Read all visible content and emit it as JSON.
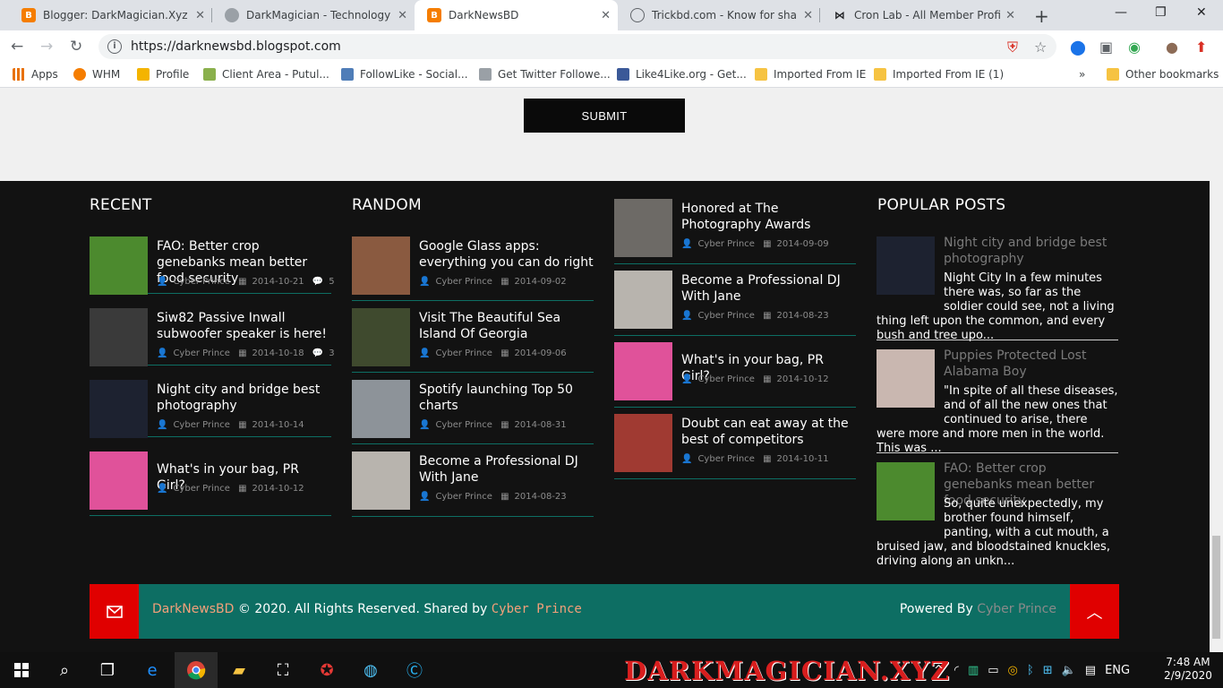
{
  "browser": {
    "tabs": [
      {
        "title": "Blogger: DarkMagician.Xyz - Cr",
        "icon": "blogger-icon",
        "color": "#f57d00"
      },
      {
        "title": "DarkMagician - Technology Fo",
        "icon": "globe-icon",
        "color": "#9aa0a6"
      },
      {
        "title": "DarkNewsBD",
        "icon": "blogger-icon",
        "color": "#f57d00"
      },
      {
        "title": "Trickbd.com - Know for sharing",
        "icon": "trickbd-icon",
        "color": "#5f6368"
      },
      {
        "title": "Cron Lab - All Member Profile",
        "icon": "bowtie-icon",
        "color": "#202124"
      }
    ],
    "url": "https://darknewsbd.blogspot.com",
    "bookmarks": [
      {
        "label": "Apps",
        "color": "#e8710a"
      },
      {
        "label": "WHM",
        "color": "#f57d00"
      },
      {
        "label": "Profile",
        "color": "#f4b400"
      },
      {
        "label": "Client Area - Putul...",
        "color": "#8ab04c"
      },
      {
        "label": "FollowLike - Social...",
        "color": "#4f7db8"
      },
      {
        "label": "Get Twitter Followe...",
        "color": "#9aa0a6"
      },
      {
        "label": "Like4Like.org - Get...",
        "color": "#3b5998"
      },
      {
        "label": "Imported From IE",
        "color": "#f6c342"
      },
      {
        "label": "Imported From IE (1)",
        "color": "#f6c342"
      },
      {
        "label": "»",
        "color": ""
      },
      {
        "label": "Other bookmarks",
        "color": "#f6c342"
      }
    ]
  },
  "form": {
    "submit_label": "SUBMIT"
  },
  "columns": {
    "recent_title": "RECENT",
    "random_title": "RANDOM",
    "popular_title": "POPULAR POSTS"
  },
  "recent": [
    {
      "title": "FAO: Better crop genebanks mean better food security",
      "author": "Cyber Prince",
      "date": "2014-10-21",
      "comments": "5",
      "thumb": "#4c8a2e"
    },
    {
      "title": "Siw82 Passive Inwall subwoofer speaker is here!",
      "author": "Cyber Prince",
      "date": "2014-10-18",
      "comments": "3",
      "thumb": "#3a3a3a"
    },
    {
      "title": "Night city and bridge best photography",
      "author": "Cyber Prince",
      "date": "2014-10-14",
      "comments": "",
      "thumb": "#1d2230"
    },
    {
      "title": "What's in your bag, PR Girl?",
      "author": "Cyber Prince",
      "date": "2014-10-12",
      "comments": "",
      "thumb": "#e0529a"
    }
  ],
  "random": [
    {
      "title": "Google Glass apps: everything you can do right",
      "author": "Cyber Prince",
      "date": "2014-09-02",
      "thumb": "#8a5a40"
    },
    {
      "title": "Visit The Beautiful Sea Island Of Georgia",
      "author": "Cyber Prince",
      "date": "2014-09-06",
      "thumb": "#3f4a2e"
    },
    {
      "title": "Spotify launching Top 50 charts",
      "author": "Cyber Prince",
      "date": "2014-08-31",
      "thumb": "#8d9399"
    },
    {
      "title": "Become a Professional DJ With Jane",
      "author": "Cyber Prince",
      "date": "2014-08-23",
      "thumb": "#b8b4ae"
    }
  ],
  "random2": [
    {
      "title": "Honored at The Photography Awards",
      "author": "Cyber Prince",
      "date": "2014-09-09",
      "thumb": "#6d6a66"
    },
    {
      "title": "Become a Professional DJ With Jane",
      "author": "Cyber Prince",
      "date": "2014-08-23",
      "thumb": "#b8b4ae"
    },
    {
      "title": "What's in your bag, PR Girl?",
      "author": "Cyber Prince",
      "date": "2014-10-12",
      "thumb": "#e0529a"
    },
    {
      "title": "Doubt can eat away at the best of competitors",
      "author": "Cyber Prince",
      "date": "2014-10-11",
      "thumb": "#a03a32"
    }
  ],
  "popular": [
    {
      "title": "Night city and bridge best photography",
      "excerpt": "Night City In a few minutes there was, so far as the soldier could see, not a living thing left upon the common, and every bush and tree upo...",
      "thumb": "#1d2230"
    },
    {
      "title": "Puppies Protected Lost Alabama Boy",
      "excerpt": "\"In spite of all these diseases, and of all the new ones that continued to arise, there were more and more men in the world. This was ...",
      "thumb": "#c9b7b0"
    },
    {
      "title": "FAO: Better crop genebanks mean better food security",
      "excerpt": "So, quite unexpectedly, my brother found himself, panting, with a cut mouth, a bruised jaw, and bloodstained knuckles, driving along an unkn...",
      "thumb": "#4c8a2e"
    }
  ],
  "footer": {
    "brand": "DarkNewsBD",
    "copyright": " © 2020. All Rights Reserved. Shared by ",
    "shared_by": "Cyber Prince",
    "powered_label": "Powered By ",
    "powered_by": "Cyber Prince",
    "accent": "#0d6e63",
    "red": "#e00000"
  },
  "taskbar": {
    "watermark": "DARKMAGICIAN.XYZ",
    "language": "ENG",
    "time": "7:48 AM",
    "date": "2/9/2020"
  }
}
